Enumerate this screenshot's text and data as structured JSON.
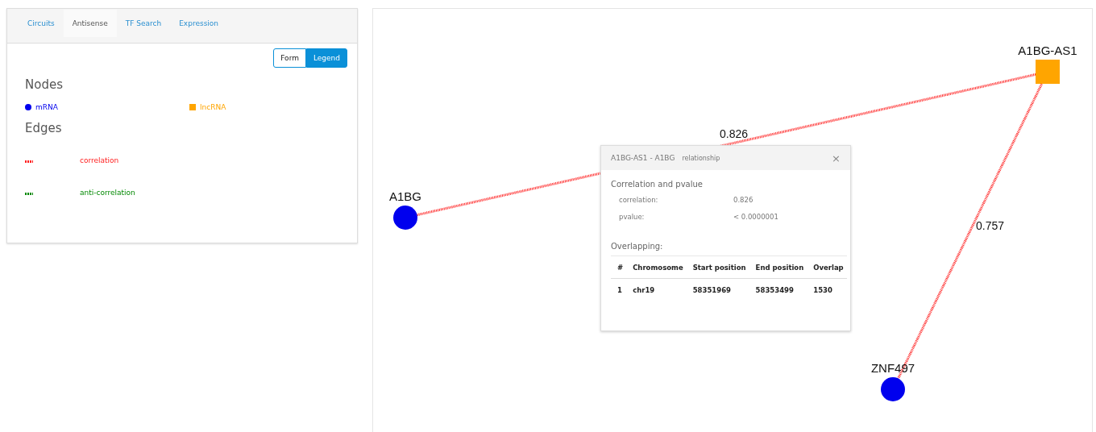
{
  "tabs": [
    {
      "label": "Circuits",
      "selected": false
    },
    {
      "label": "Antisense",
      "selected": true
    },
    {
      "label": "TF Search",
      "selected": false
    },
    {
      "label": "Expression",
      "selected": false
    }
  ],
  "toggle": [
    {
      "label": "Form",
      "selected": false
    },
    {
      "label": "Legend",
      "selected": true
    }
  ],
  "legend": {
    "nodes_title": "Nodes",
    "nodes": [
      {
        "label": "mRNA",
        "kind": "circle",
        "color": "#0000ee"
      },
      {
        "label": "lncRNA",
        "kind": "square",
        "color": "#ffa500"
      }
    ],
    "edges_title": "Edges",
    "edges": [
      {
        "label": "correlation",
        "color": "#ff2020"
      },
      {
        "label": "anti-correlation",
        "color": "#008800"
      }
    ]
  },
  "graph": {
    "nodes": [
      {
        "label": "A1BG",
        "kind": "circle",
        "color": "#0000ee"
      },
      {
        "label": "A1BG-AS1",
        "kind": "square",
        "color": "#ffa500"
      },
      {
        "label": "ZNF497",
        "kind": "circle",
        "color": "#0000ee"
      }
    ],
    "edges": [
      {
        "label": "0.826",
        "color": "#ff2020"
      },
      {
        "label": "0.757",
        "color": "#ff2020"
      }
    ]
  },
  "popup": {
    "title": "A1BG-AS1  -  A1BG",
    "subtitle": "relationship",
    "close": "×",
    "section1": "Correlation and pvalue",
    "stats": [
      {
        "label": "correlation:",
        "value": "0.826"
      },
      {
        "label": "pvalue:",
        "value": "< 0.0000001"
      }
    ],
    "section2": "Overlapping:",
    "columns": [
      "#",
      "Chromosome",
      "Start position",
      "End position",
      "Overlap"
    ],
    "rows": [
      [
        "1",
        "chr19",
        "58351969",
        "58353499",
        "1530"
      ]
    ]
  }
}
